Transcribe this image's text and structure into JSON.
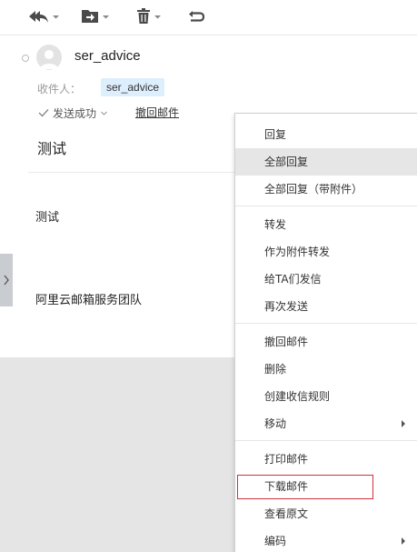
{
  "toolbar": {
    "reply_icon": "reply-all-icon",
    "move_icon": "move-to-folder-icon",
    "delete_icon": "trash-icon",
    "undo_icon": "undo-icon"
  },
  "mail": {
    "sender": "ser_advice",
    "recipient_label": "收件人：",
    "recipient": "ser_advice",
    "send_status": "发送成功",
    "recall_link": "撤回邮件",
    "subject": "测试",
    "body_line1": "测试",
    "body_line2": "阿里云邮箱服务团队"
  },
  "menu": {
    "items": [
      {
        "label": "回复"
      },
      {
        "label": "全部回复"
      },
      {
        "label": "全部回复（带附件）"
      },
      {
        "label": "转发"
      },
      {
        "label": "作为附件转发"
      },
      {
        "label": "给TA们发信"
      },
      {
        "label": "再次发送"
      },
      {
        "label": "撤回邮件"
      },
      {
        "label": "删除"
      },
      {
        "label": "创建收信规则"
      },
      {
        "label": "移动"
      },
      {
        "label": "打印邮件"
      },
      {
        "label": "下载邮件"
      },
      {
        "label": "查看原文"
      },
      {
        "label": "编码"
      }
    ]
  },
  "colors": {
    "highlight_border": "#d4303a",
    "chip_bg": "#ddeefd",
    "hover_bg": "#e6e6e6",
    "bottom_bg": "#e5e5e5"
  }
}
